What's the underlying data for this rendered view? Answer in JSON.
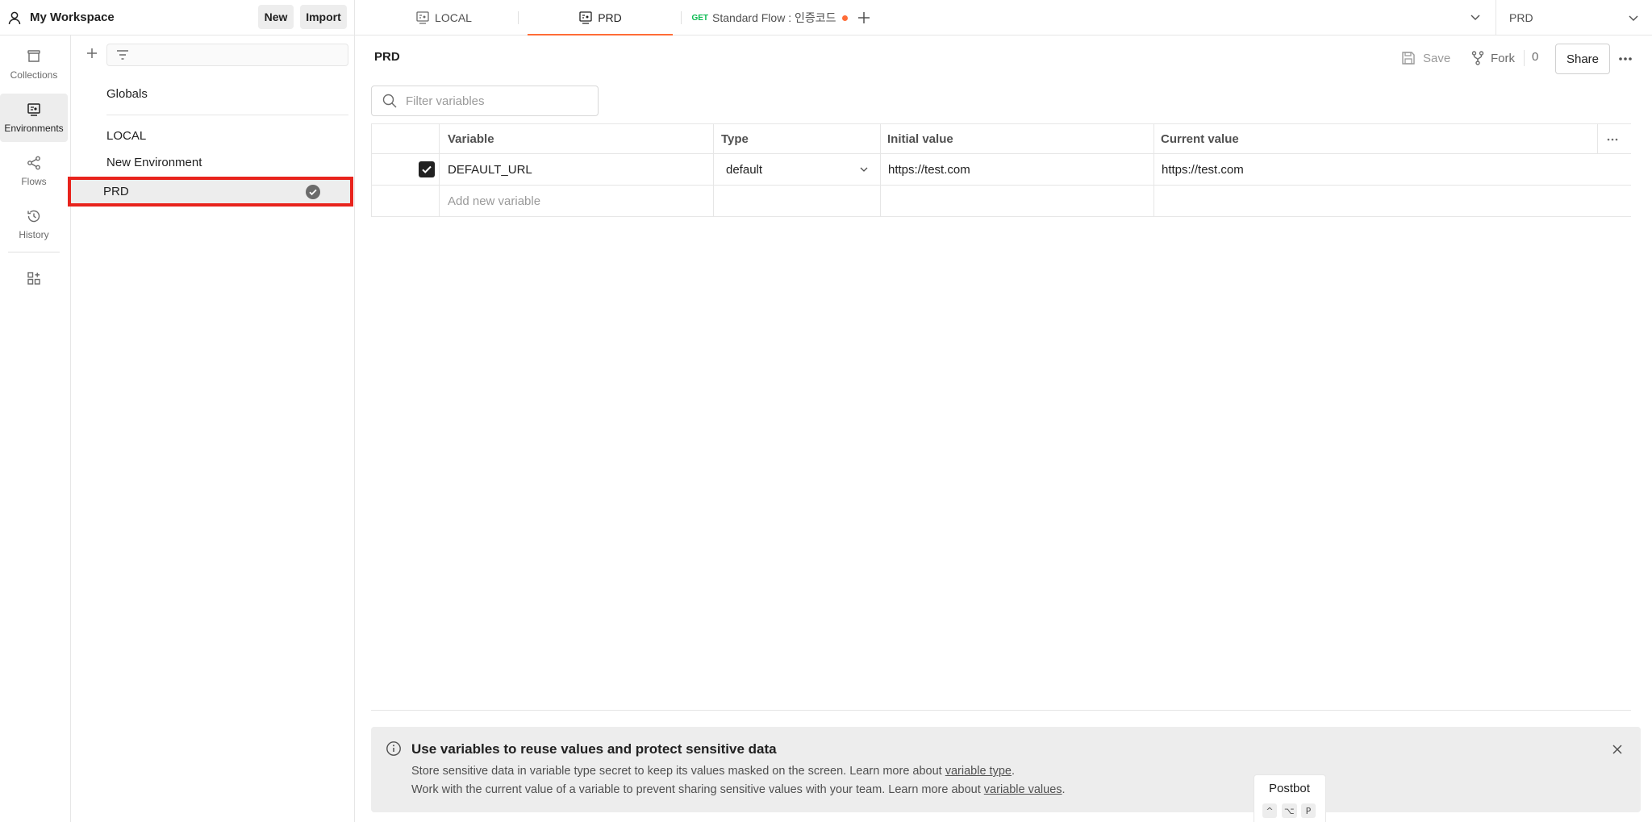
{
  "workspace": {
    "title": "My Workspace",
    "new_label": "New",
    "import_label": "Import"
  },
  "sidebar": {
    "items": [
      {
        "label": "Collections",
        "icon": "collections-icon",
        "active": false
      },
      {
        "label": "Environments",
        "icon": "environments-icon",
        "active": true
      },
      {
        "label": "Flows",
        "icon": "flows-icon",
        "active": false
      },
      {
        "label": "History",
        "icon": "history-icon",
        "active": false
      }
    ]
  },
  "environments": {
    "globals_label": "Globals",
    "items": [
      {
        "label": "LOCAL"
      },
      {
        "label": "New Environment"
      },
      {
        "label": "PRD",
        "active": true
      }
    ]
  },
  "tabs": [
    {
      "label": "LOCAL",
      "icon": "environment-icon"
    },
    {
      "label": "PRD",
      "icon": "environment-icon",
      "active": true
    },
    {
      "method": "GET",
      "label": "Standard Flow : 인증코드",
      "unsaved": true
    }
  ],
  "env_selector": {
    "value": "PRD"
  },
  "main": {
    "title": "PRD",
    "save_label": "Save",
    "fork_label": "Fork",
    "fork_count": "0",
    "share_label": "Share",
    "filter_placeholder": "Filter variables"
  },
  "table": {
    "headers": {
      "variable": "Variable",
      "type": "Type",
      "initial": "Initial value",
      "current": "Current value"
    },
    "rows": [
      {
        "enabled": true,
        "variable": "DEFAULT_URL",
        "type": "default",
        "initial": "https://test.com",
        "current": "https://test.com"
      }
    ],
    "add_placeholder": "Add new variable"
  },
  "banner": {
    "title": "Use variables to reuse values and protect sensitive data",
    "line1_text": "Store sensitive data in variable type secret to keep its values masked on the screen. Learn more about ",
    "line1_link": "variable type",
    "line1_end": ".",
    "line2_text": "Work with the current value of a variable to prevent sharing sensitive values with your team. Learn more about ",
    "line2_link": "variable values",
    "line2_end": "."
  },
  "postbot": {
    "label": "Postbot",
    "keys": [
      "^",
      "⌥",
      "P"
    ]
  },
  "colors": {
    "accent": "#ff6c37",
    "highlight_border": "#e8231c",
    "get_method": "#0cbb52"
  }
}
